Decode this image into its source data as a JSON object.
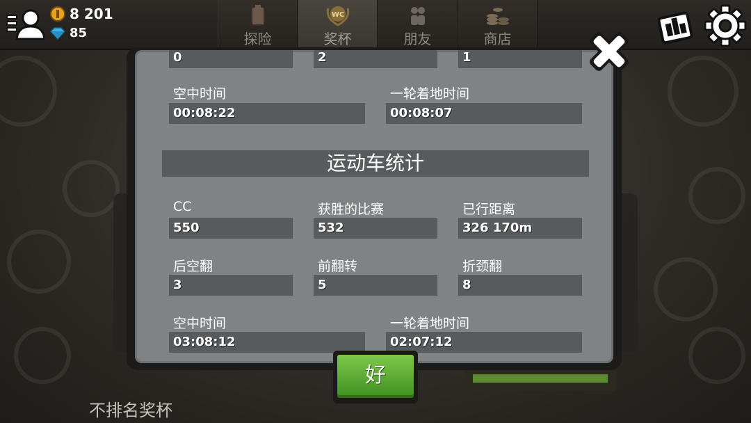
{
  "header": {
    "coins": "8 201",
    "gems": "85",
    "tabs": [
      {
        "label": "探险",
        "icon": "fuel-can-icon"
      },
      {
        "label": "奖杯",
        "icon": "wc-trophy-icon"
      },
      {
        "label": "朋友",
        "icon": "friends-icon"
      },
      {
        "label": "商店",
        "icon": "coin-stacks-icon"
      }
    ],
    "active_tab": "奖杯"
  },
  "dialog": {
    "top_row_values": [
      "0",
      "2",
      "1"
    ],
    "prev_section": {
      "air_time_label": "空中时间",
      "air_time_value": "00:08:22",
      "wheelie_label": "一轮着地时间",
      "wheelie_value": "00:08:07"
    },
    "section_title": "运动车统计",
    "stats": {
      "row1": [
        {
          "label": "CC",
          "value": "550"
        },
        {
          "label": "获胜的比赛",
          "value": "532"
        },
        {
          "label": "已行距离",
          "value": "326 170m"
        }
      ],
      "row2": [
        {
          "label": "后空翻",
          "value": "3"
        },
        {
          "label": "前翻转",
          "value": "5"
        },
        {
          "label": "折颈翻",
          "value": "8"
        }
      ],
      "air_time_label": "空中时间",
      "air_time_value": "03:08:12",
      "wheelie_label": "一轮着地时间",
      "wheelie_value": "02:07:12"
    },
    "ok_label": "好"
  },
  "footer": {
    "label": "不排名奖杯"
  },
  "colors": {
    "ok_green": "#5cb036",
    "panel_grey": "#7f8386",
    "field_grey": "#575b5e"
  }
}
